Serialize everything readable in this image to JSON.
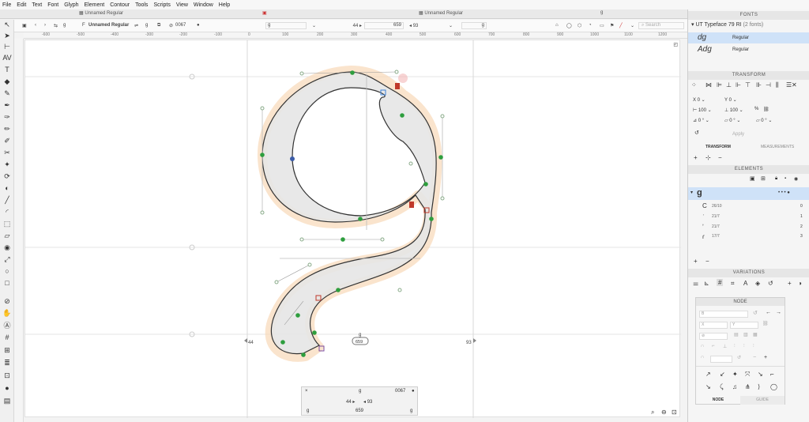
{
  "menu": [
    "File",
    "Edit",
    "Text",
    "Font",
    "Glyph",
    "Element",
    "Contour",
    "Tools",
    "Scripts",
    "View",
    "Window",
    "Help"
  ],
  "tabs": {
    "left": "Unnamed Regular",
    "center": "Unnamed Regular",
    "right": "g"
  },
  "toolbar": {
    "font_name": "Unnamed Regular",
    "glyph_char": "g",
    "unicode": "0067",
    "left_glyph": "g",
    "lsb": "44",
    "advance": "659",
    "rsb": "93",
    "right_glyph": "g",
    "search_placeholder": "Search"
  },
  "ruler_ticks": [
    "-600",
    "-500",
    "-400",
    "-300",
    "-200",
    "-100",
    "0",
    "100",
    "200",
    "300",
    "400",
    "500",
    "600",
    "700",
    "800",
    "900",
    "1000",
    "1100",
    "1200"
  ],
  "canvas": {
    "lsb_label": "44",
    "rsb_label": "93",
    "advance_label": "659",
    "glyph_name": "g"
  },
  "status": {
    "glyph": "g",
    "unicode": "0067",
    "lsb": "44",
    "rsb": "93",
    "left_glyph": "g",
    "advance": "659",
    "right_glyph": "g"
  },
  "fonts": {
    "header": "FONTS",
    "family": "UT Typeface 79 RI",
    "count": "(2 fonts)",
    "items": [
      {
        "sample": "dg",
        "style": "Regular"
      },
      {
        "sample": "Adg",
        "style": "Regular"
      }
    ]
  },
  "transform": {
    "header": "TRANSFORM",
    "x": "0",
    "y": "0",
    "w": "100",
    "h": "100",
    "angle1": "0 °",
    "angle2": "0 °",
    "angle3": "0 °",
    "apply": "Apply",
    "tabs": [
      "TRANSFORM",
      "MEASUREMENTS"
    ]
  },
  "elements": {
    "header": "ELEMENTS",
    "rows": [
      {
        "label": "26/10",
        "count": "0"
      },
      {
        "label": "21/7",
        "count": "1"
      },
      {
        "label": "21/7",
        "count": "2"
      },
      {
        "label": "17/7",
        "count": "3"
      }
    ]
  },
  "variations": {
    "header": "VARIATIONS"
  },
  "node": {
    "header": "NODE",
    "tabs": [
      "NODE",
      "GUIDE"
    ]
  },
  "colors": {
    "accent": "#3b7fd6",
    "selection": "#cfe2f8",
    "glyph_fill": "#e6e6e6",
    "node_green": "#2e9e3e",
    "outline_glow": "#f8d9b8"
  }
}
